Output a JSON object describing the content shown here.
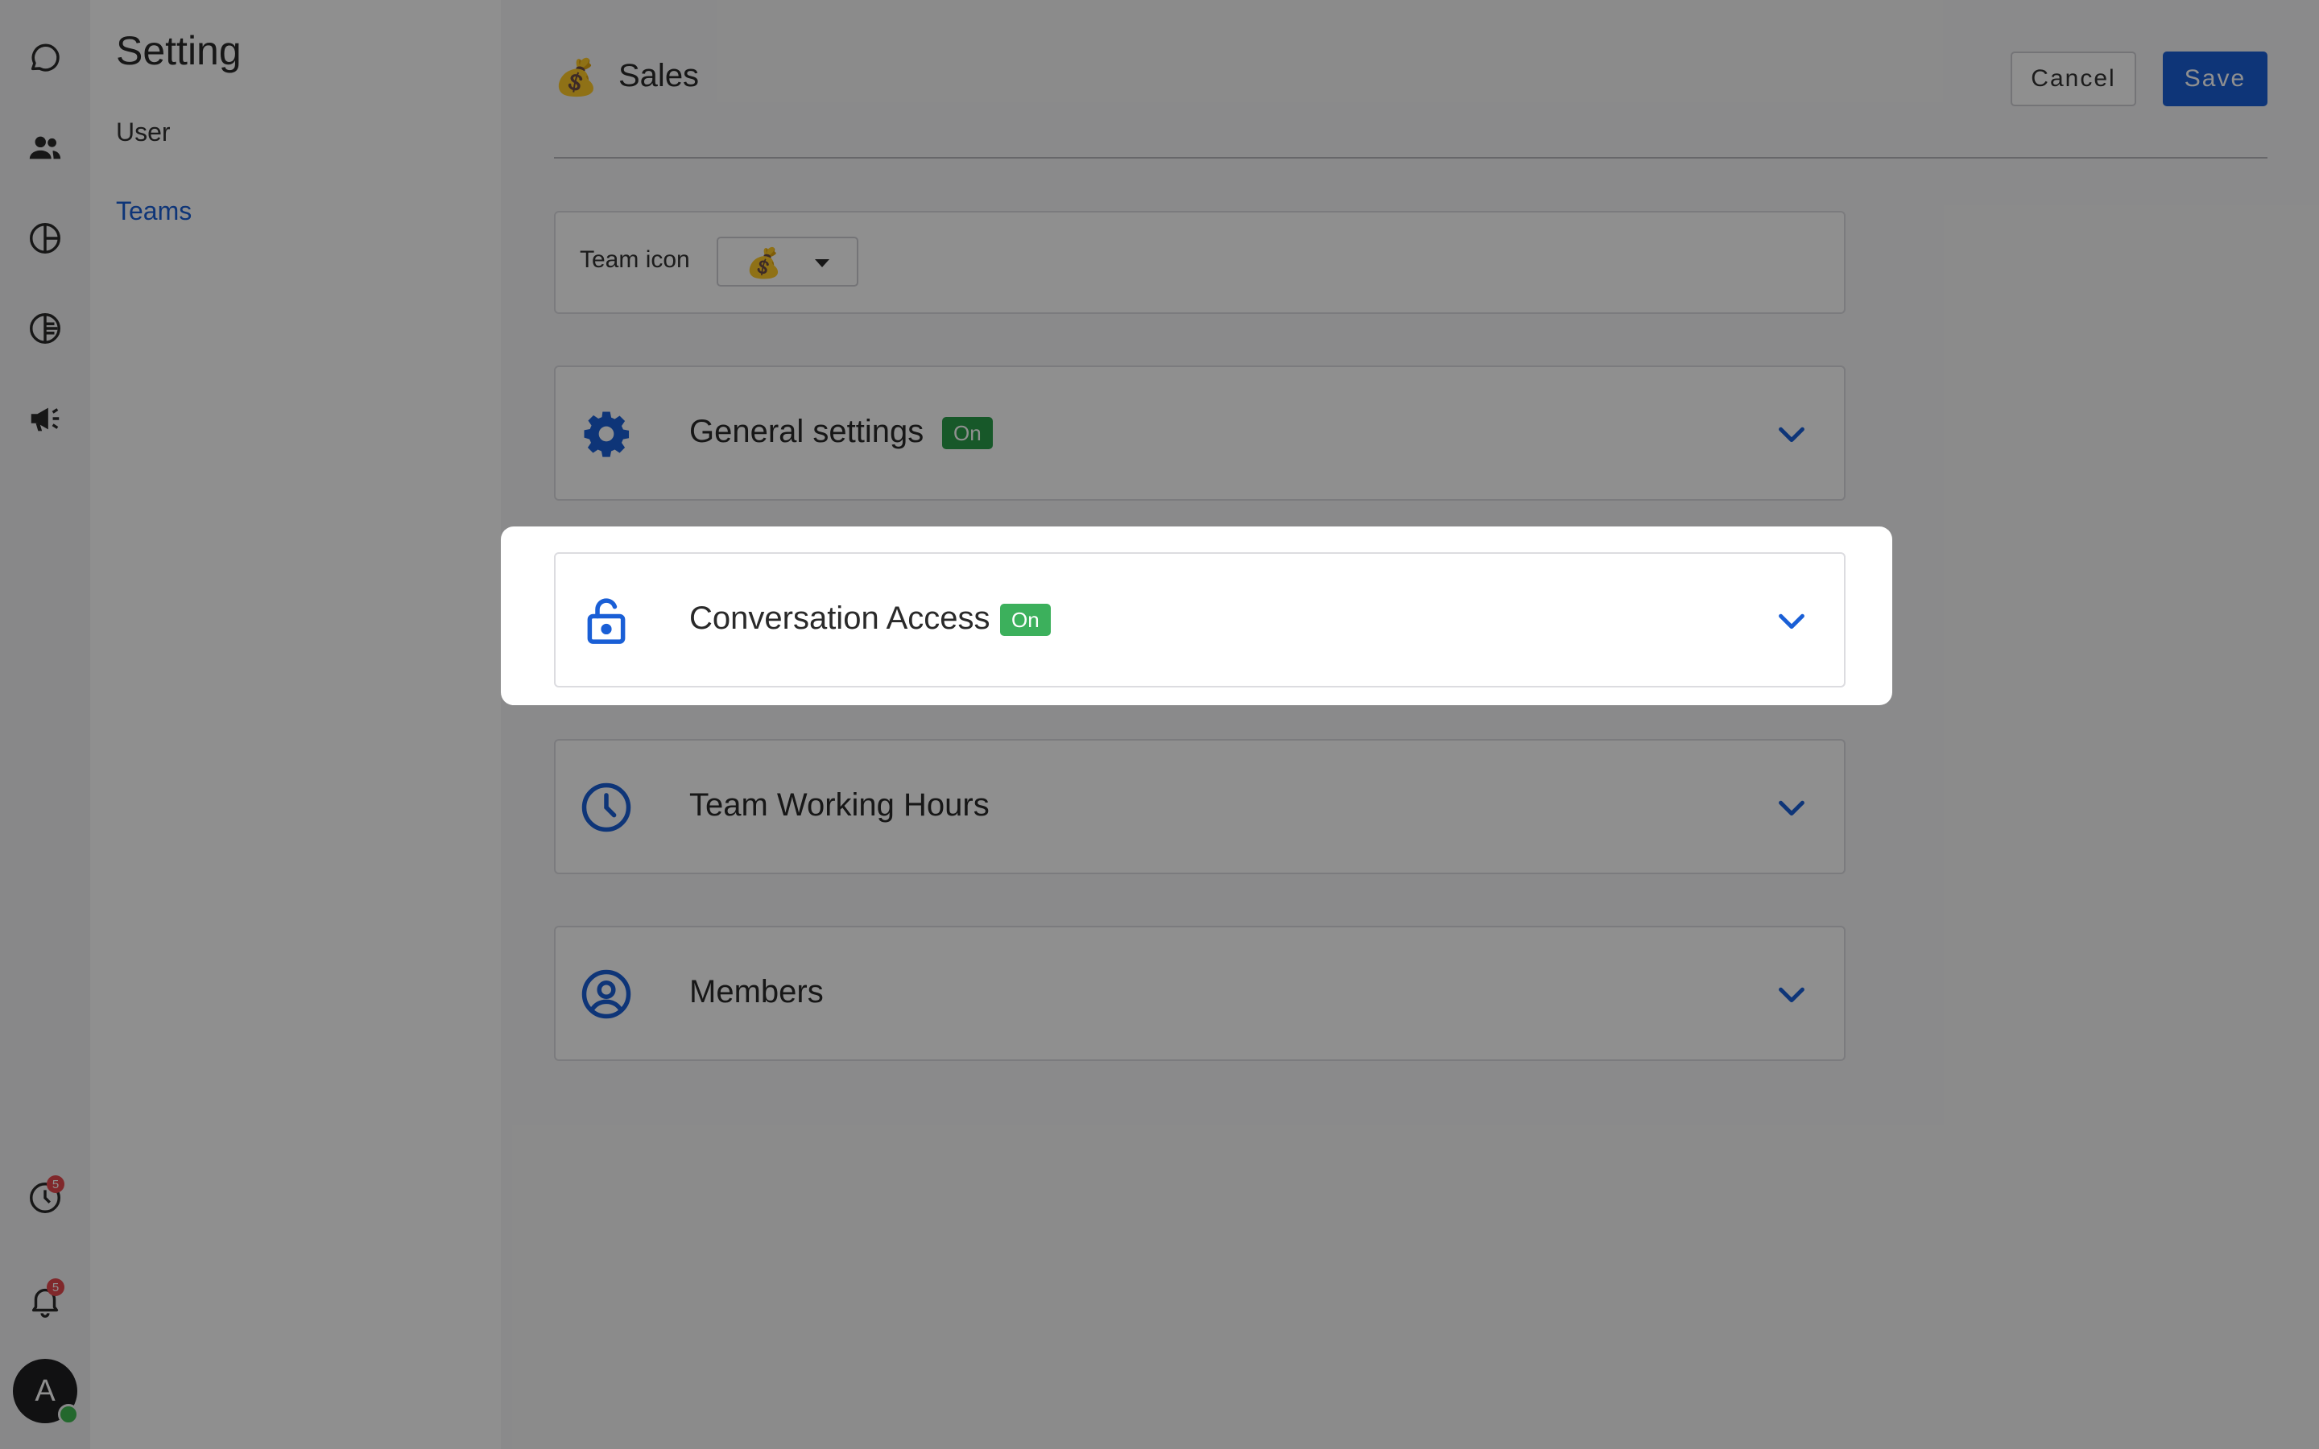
{
  "colors": {
    "accent": "#1a5fd6",
    "badge_on": "#2a9d4a",
    "badge_on_bright": "#3cb05c",
    "notification": "#e5484d"
  },
  "rail": {
    "items": [
      {
        "name": "chat-icon"
      },
      {
        "name": "contacts-icon"
      },
      {
        "name": "reports-icon"
      },
      {
        "name": "analytics-icon"
      },
      {
        "name": "broadcast-icon"
      }
    ],
    "history_badge": "5",
    "notifications_badge": "5",
    "avatar_initial": "A"
  },
  "sidebar": {
    "title": "Setting",
    "items": [
      {
        "label": "User",
        "active": false
      },
      {
        "label": "Teams",
        "active": true
      }
    ]
  },
  "header": {
    "team_emoji": "💰",
    "team_name": "Sales",
    "cancel_label": "Cancel",
    "save_label": "Save"
  },
  "team_icon": {
    "label": "Team icon",
    "selected_emoji": "💰"
  },
  "sections": [
    {
      "title": "General settings",
      "badge": "On",
      "icon": "gear-icon"
    },
    {
      "title": "Conversation Access",
      "badge": "On",
      "icon": "lock-icon",
      "highlighted": true
    },
    {
      "title": "Team Working Hours",
      "badge": "",
      "icon": "clock-icon"
    },
    {
      "title": "Members",
      "badge": "",
      "icon": "user-circle-icon"
    }
  ]
}
